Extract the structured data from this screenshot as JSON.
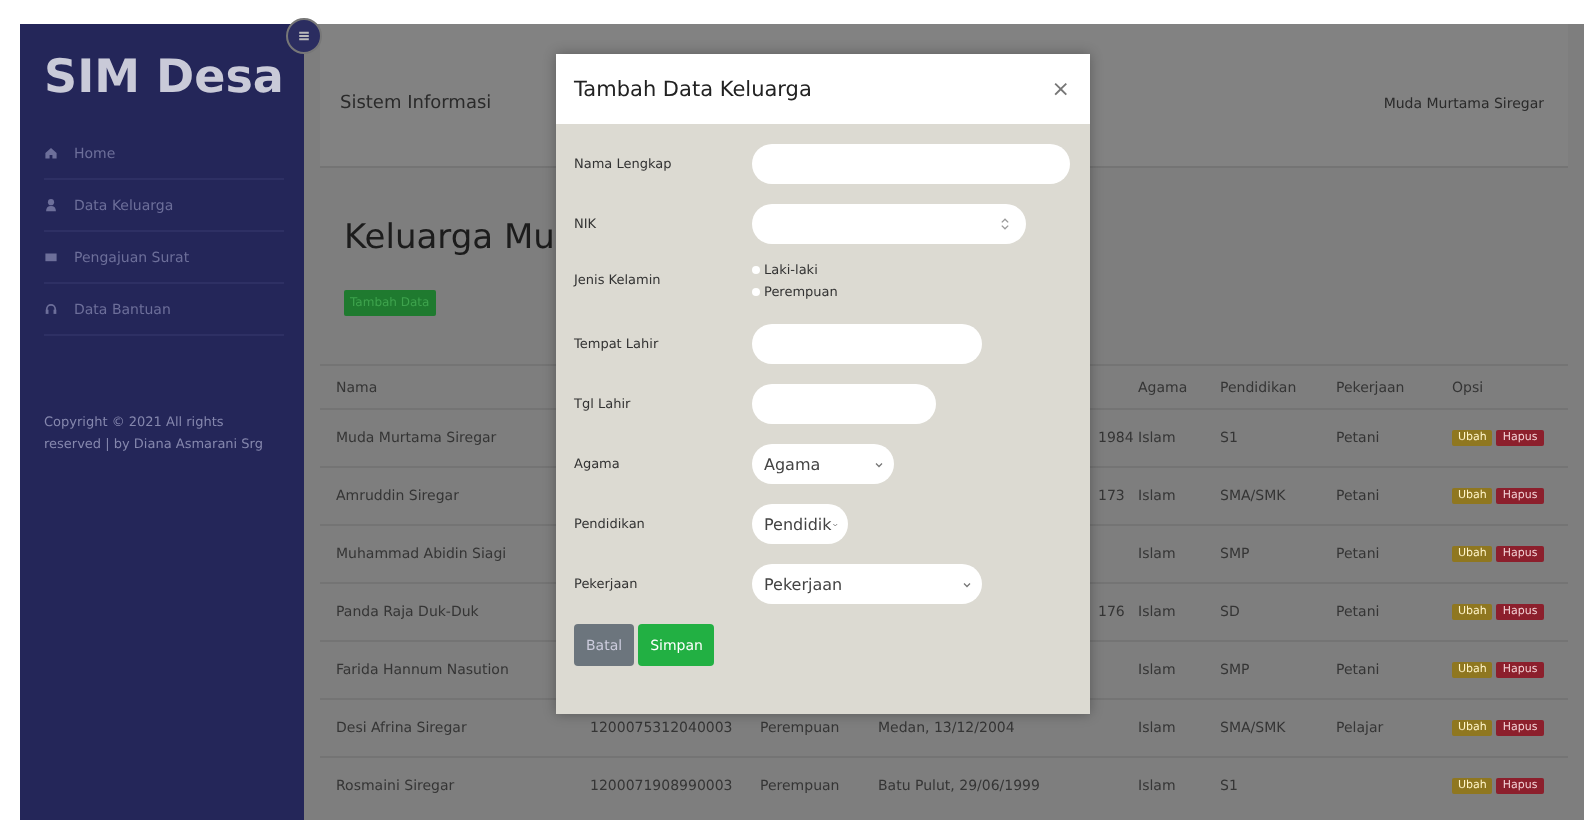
{
  "sidebar": {
    "brand": "SIM Desa",
    "items": [
      {
        "label": "Home"
      },
      {
        "label": "Data Keluarga"
      },
      {
        "label": "Pengajuan Surat"
      },
      {
        "label": "Data Bantuan"
      }
    ],
    "copyright": "Copyright © 2021 All rights reserved | by Diana Asmarani Srg"
  },
  "header": {
    "title": "Sistem Informasi",
    "user": "Muda Murtama Siregar"
  },
  "page": {
    "heading": "Keluarga Mu",
    "add_button": "Tambah Data"
  },
  "table": {
    "columns": [
      "Nama",
      "Agama",
      "Pendidikan",
      "Pekerjaan",
      "Opsi"
    ],
    "rows": [
      {
        "kind": "partial",
        "nama": "Muda Murtama Siregar",
        "ttl": "1984",
        "agama": "Islam",
        "pendidikan": "S1",
        "pekerjaan": "Petani",
        "actions": [
          "Ubah",
          "Hapus"
        ]
      },
      {
        "kind": "partial",
        "nama": "Amruddin Siregar",
        "ttl": "173",
        "agama": "Islam",
        "pendidikan": "SMA/SMK",
        "pekerjaan": "Petani",
        "actions": [
          "Ubah",
          "Hapus"
        ]
      },
      {
        "kind": "partial",
        "nama": "Muhammad Abidin Siagi",
        "agama": "Islam",
        "pendidikan": "SMP",
        "pekerjaan": "Petani",
        "actions": [
          "Ubah",
          "Hapus"
        ]
      },
      {
        "kind": "partial",
        "nama": "Panda Raja Duk-Duk",
        "ttl": "176",
        "agama": "Islam",
        "pendidikan": "SD",
        "pekerjaan": "Petani",
        "actions": [
          "Ubah",
          "Hapus"
        ]
      },
      {
        "kind": "partial",
        "nama": "Farida Hannum Nasution",
        "agama": "Islam",
        "pendidikan": "SMP",
        "pekerjaan": "Petani",
        "actions": [
          "Ubah",
          "Hapus"
        ]
      },
      {
        "kind": "full",
        "nama": "Desi Afrina Siregar",
        "nik": "1200075312040003",
        "jk": "Perempuan",
        "ttl": "Medan, 13/12/2004",
        "agama": "Islam",
        "pendidikan": "SMA/SMK",
        "pekerjaan": "Pelajar",
        "actions": [
          "Ubah",
          "Hapus"
        ]
      },
      {
        "kind": "full",
        "nama": "Rosmaini Siregar",
        "nik": "1200071908990003",
        "jk": "Perempuan",
        "ttl": "Batu Pulut, 29/06/1999",
        "agama": "Islam",
        "pendidikan": "S1",
        "actions": [
          "Ubah",
          "Hapus"
        ]
      }
    ]
  },
  "modal": {
    "title": "Tambah Data Keluarga",
    "close": "×",
    "fields": [
      {
        "kind": "text",
        "label": "Nama Lengkap"
      },
      {
        "kind": "number",
        "label": "NIK"
      },
      {
        "kind": "radio",
        "label": "Jenis Kelamin",
        "options": [
          {
            "label": "Laki-laki",
            "selected": false
          },
          {
            "label": "Perempuan",
            "selected": false
          }
        ]
      },
      {
        "kind": "text",
        "label": "Tempat Lahir"
      },
      {
        "kind": "text",
        "label": "Tgl Lahir"
      },
      {
        "kind": "select",
        "label": "Agama",
        "value": "Agama"
      },
      {
        "kind": "select",
        "label": "Pendidikan",
        "value": "Pendidik"
      },
      {
        "kind": "select",
        "label": "Pekerjaan",
        "value": "Pekerjaan"
      }
    ],
    "buttons": [
      {
        "kind": "cancel",
        "label": "Batal"
      },
      {
        "kind": "submit",
        "label": "Simpan"
      }
    ]
  }
}
